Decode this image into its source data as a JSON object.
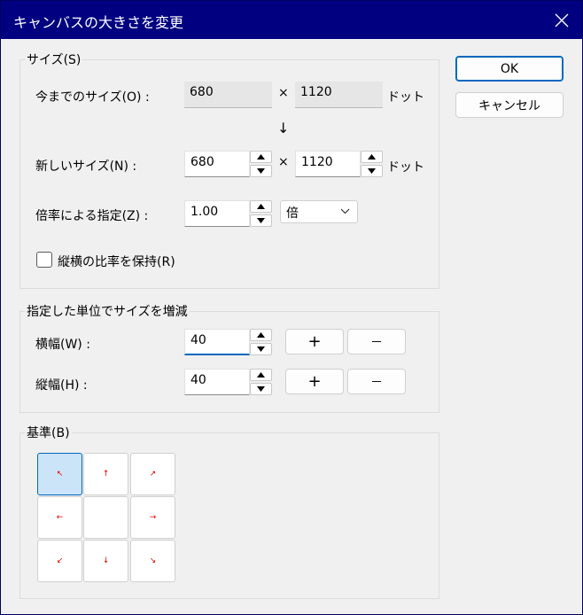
{
  "window": {
    "title": "キャンバスの大きさを変更",
    "accent_color": "#000080"
  },
  "size_group": {
    "legend": "サイズ(S)",
    "current_label": "今までのサイズ(O) :",
    "current_width": "680",
    "current_height": "1120",
    "unit": "ドット",
    "times": "×",
    "down_arrow": "↓",
    "new_label": "新しいサイズ(N) :",
    "new_width": "680",
    "new_height": "1120",
    "ratio_label": "倍率による指定(Z) :",
    "ratio_value": "1.00",
    "ratio_unit_selected": "倍",
    "keep_aspect_label": "縦横の比率を保持(R)",
    "keep_aspect_checked": false
  },
  "increment_group": {
    "legend": "指定した単位でサイズを増減",
    "width_label": "横幅(W) :",
    "width_value": "40",
    "height_label": "縦幅(H) :",
    "height_value": "40",
    "plus": "+",
    "minus": "－"
  },
  "anchor_group": {
    "legend": "基準(B)",
    "cells": [
      "↖",
      "↑",
      "↗",
      "←",
      "",
      "→",
      "↙",
      "↓",
      "↘"
    ],
    "selected_index": 0,
    "arrow_color": "#e00000"
  },
  "buttons": {
    "ok": "OK",
    "cancel": "キャンセル"
  }
}
